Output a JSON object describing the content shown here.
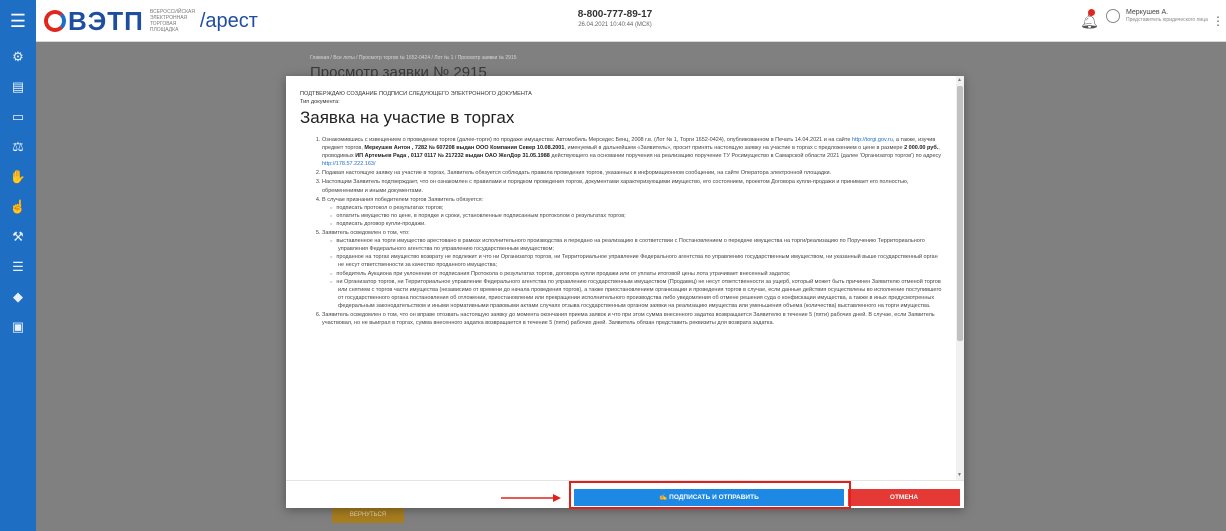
{
  "header": {
    "logo_text": "ВЭТП",
    "logo_subtitle": "ВСЕРОССИЙСКАЯ ЭЛЕКТРОННАЯ ТОРГОВАЯ ПЛОЩАДКА",
    "section": "/арест",
    "phone": "8-800-777-89-17",
    "datetime": "26.04.2021 10:40:44 (МСК)",
    "user_name": "Меркушев А.",
    "user_role": "Представитель юридического лица",
    "menu_icon": "hamburger-icon",
    "bell_icon": "bell-icon"
  },
  "sidebar": {
    "items": [
      {
        "icon": "gear-icon",
        "glyph": "⚙"
      },
      {
        "icon": "document-icon",
        "glyph": "▤"
      },
      {
        "icon": "folder-icon",
        "glyph": "▭"
      },
      {
        "icon": "auction-icon",
        "glyph": "⚖"
      },
      {
        "icon": "hand-icon",
        "glyph": "✋"
      },
      {
        "icon": "thumb-icon",
        "glyph": "☝"
      },
      {
        "icon": "hammer-icon",
        "glyph": "⚒"
      },
      {
        "icon": "list-icon",
        "glyph": "☰"
      },
      {
        "icon": "bag-icon",
        "glyph": "◆"
      },
      {
        "icon": "report-icon",
        "glyph": "▣"
      }
    ]
  },
  "background": {
    "breadcrumbs": "Главная / Все лоты / Просмотр торгов № 1652-0424 / Лот № 1 / Просмотр заявки № 2915",
    "page_title": "Просмотр заявки № 2915",
    "bottom_button": "ВЕРНУТЬСЯ"
  },
  "modal": {
    "confirm_heading": "ПОДТВЕРЖДАЮ СОЗДАНИЕ ПОДПИСИ СЛЕДУЮЩЕГО ЭЛЕКТРОННОГО ДОКУМЕНТА",
    "doc_type_label": "Тип документа:",
    "doc_title": "Заявка на участие в торгах",
    "p1_a": "Ознакомившись с извещением о проведении торгов (далее-торги) по продаже имущества: Автомобиль Мерседес Бенц, 2008 г.в. (Лот № 1, Торги 1652-0424), опубликованном в Печать 14.04.2021 и на сайте ",
    "p1_link": "http://torgi.gov.ru",
    "p1_b": ", а также, изучив предмет торгов, ",
    "p1_bold": "Меркушев Антон , 7282 № 607208 выдан ООО Компания Север 10.08.2001",
    "p1_c": ", именуемый в дальнейшем «Заявитель», просит принять настоящую заявку на участие в торгах с предложением о цене в размере ",
    "p1_price": "2 000.00 руб.",
    "p1_d": ", проводимых ",
    "p1_org": "ИП Артемьев Рада , 0117 0117 № 217232 выдан ОАО ЖелДор 31.05.1988",
    "p1_e": " действующего на основании поручения на реализацию поручение ТУ Росимущество в Самарской области 2021 (далее 'Организатор торгов') по адресу ",
    "p1_link2": "http://178.57.222.163/",
    "p2": "Подавая настоящую заявку на участие в торгах, Заявитель обязуется соблюдать правила проведения торгов, указанных в информационном сообщении, на сайте Оператора электронной площадки.",
    "p3": "Настоящим Заявитель подтверждает, что он ознакомлен с правилами и порядком проведения торгов, документами характеризующими имущество, его состоянием, проектом Договора купли-продажи и принимает его полностью, обременениями и иными документами.",
    "p4": "В случае признания победителем торгов Заявитель обязуется:",
    "p4_items": [
      "подписать протокол о результатах торгов;",
      "оплатить имущество по цене, в порядке и сроки, установленные подписанным протоколом о результатах торгов;",
      "подписать договор купли-продажи."
    ],
    "p5": "Заявитель осведомлен о том, что:",
    "p5_items": [
      "выставленное на торги имущество арестовано в рамках исполнительного производства и передано на реализацию в соответствии с Постановлением о передаче имущества на торги/реализацию по Поручению Территориального управления Федерального агентства по управлению государственным имуществом;",
      "проданное на торгах имущество возврату не подлежит и что ни Организатор торгов, ни Территориальное управление Федерального агентства по управлению государственным имуществом, ни указанный выше государственный орган не несут ответственности за качество проданного имущества;",
      "победитель Аукциона при уклонении от подписания Протокола о результатах торгов, договора купли продажи или от уплаты итоговой цены лота утрачивает внесенный задаток;",
      "ни Организатор торгов, ни Территориальное управление Федерального агентства по управлению государственным имуществом (Продавец) не несут ответственности за ущерб, который может быть причинен Заявителю отменой торгов или снятием с торгов части имущества (независимо от времени до начала проведения торгов), а также приостановлением организации и проведения торгов в случае, если данные действия осуществлены во исполнение поступившего от государственного органа постановления об отложении, приостановлении или прекращении исполнительного производства либо уведомления об отмене решения суда о конфискации имущества, а также в иных предусмотренных федеральным законодательством и иными нормативными правовыми актами случаях отзыва государственным органом заявки на реализацию имущества или уменьшения объема (количества) выставленного на торги имущества."
    ],
    "p6": "Заявитель осведомлен о том, что он вправе отозвать настоящую заявку до момента окончания приема заявок и что при этом сумма внесенного задатка возвращается Заявителю в течение 5 (пяти) рабочих дней. В случае, если Заявитель участвовал, но не выиграл в торгах, сумма внесенного задатка возвращается в течение 5 (пяти) рабочих дней. Заявитель обязан представить реквизиты для возврата задатка.",
    "sign_button": "ПОДПИСАТЬ И ОТПРАВИТЬ",
    "cancel_button": "ОТМЕНА"
  },
  "colors": {
    "primary_blue": "#1e6fc4",
    "sign_button": "#1e88e5",
    "cancel_button": "#e53935",
    "annotation_red": "#e0201b"
  }
}
